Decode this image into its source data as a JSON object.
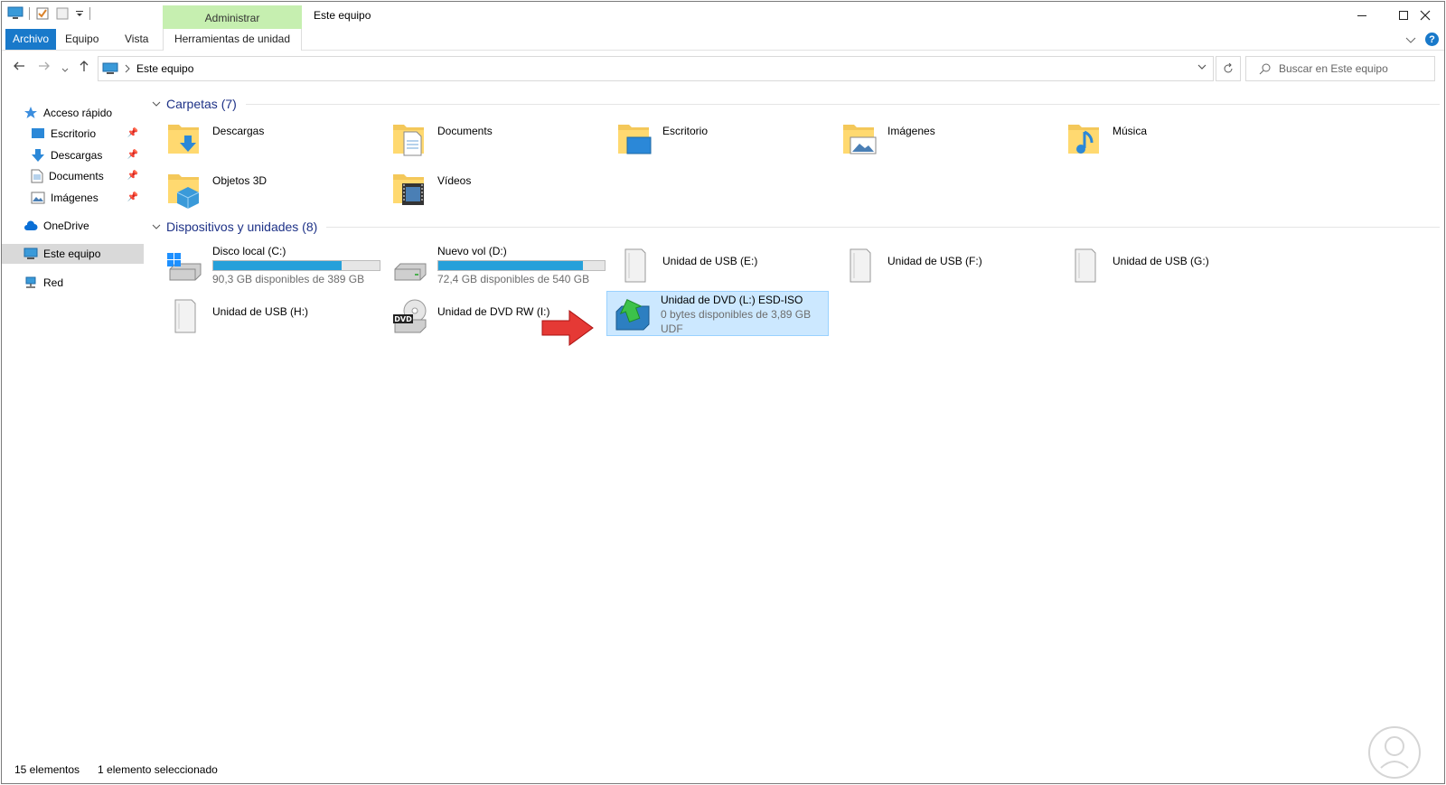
{
  "window": {
    "title": "Este equipo",
    "ribbon_context_group": "Administrar",
    "tabs": [
      {
        "label": "Archivo"
      },
      {
        "label": "Equipo"
      },
      {
        "label": "Vista"
      },
      {
        "label": "Herramientas de unidad"
      }
    ]
  },
  "address": {
    "path": "Este equipo",
    "search_placeholder": "Buscar en Este equipo"
  },
  "sidebar": {
    "items": [
      {
        "label": "Acceso rápido"
      },
      {
        "label": "Escritorio"
      },
      {
        "label": "Descargas"
      },
      {
        "label": "Documents"
      },
      {
        "label": "Imágenes"
      },
      {
        "label": "OneDrive"
      },
      {
        "label": "Este equipo"
      },
      {
        "label": "Red"
      }
    ]
  },
  "folders": {
    "title": "Carpetas (7)",
    "items": [
      {
        "label": "Descargas"
      },
      {
        "label": "Documents"
      },
      {
        "label": "Escritorio"
      },
      {
        "label": "Imágenes"
      },
      {
        "label": "Música"
      },
      {
        "label": "Objetos 3D"
      },
      {
        "label": "Vídeos"
      }
    ]
  },
  "devices": {
    "title": "Dispositivos y unidades (8)",
    "items": [
      {
        "label": "Disco local (C:)",
        "free": "90,3 GB disponibles de 389 GB",
        "used_fraction": 0.77
      },
      {
        "label": "Nuevo vol (D:)",
        "free": "72,4 GB disponibles de 540 GB",
        "used_fraction": 0.87
      },
      {
        "label": "Unidad de USB (E:)"
      },
      {
        "label": "Unidad de USB (F:)"
      },
      {
        "label": "Unidad de USB (G:)"
      },
      {
        "label": "Unidad de USB (H:)"
      },
      {
        "label": "Unidad de DVD RW (I:)",
        "icon_text": "DVD"
      },
      {
        "label": "Unidad de DVD (L:) ESD-ISO",
        "free": "0 bytes disponibles de 3,89 GB",
        "fs": "UDF"
      }
    ]
  },
  "status": {
    "count": "15 elementos",
    "selected": "1 elemento seleccionado"
  },
  "colors": {
    "accent": "#1979ca",
    "context_tab": "#c6efb0",
    "selection": "#cce8ff",
    "bar_fill": "#26a0da",
    "group_title": "#1e3287",
    "arrow": "#e53935"
  }
}
